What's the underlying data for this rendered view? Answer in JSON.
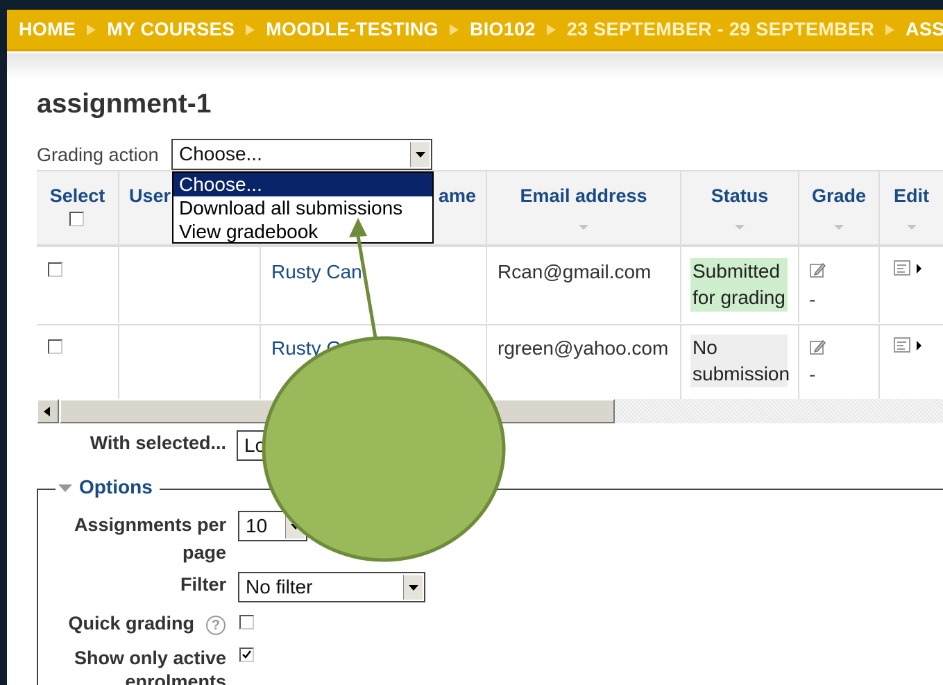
{
  "breadcrumb": {
    "items": [
      "HOME",
      "MY COURSES",
      "MOODLE-TESTING",
      "BIO102",
      "23 SEPTEMBER - 29 SEPTEMBER",
      "ASSIGNMEN"
    ]
  },
  "page": {
    "title": "assignment-1"
  },
  "grading_action": {
    "label": "Grading action",
    "selected": "Choose...",
    "options": [
      "Choose...",
      "Download all submissions",
      "View gradebook"
    ]
  },
  "table": {
    "headers": {
      "select": "Select",
      "user": "User",
      "name": "ame",
      "email": "Email address",
      "status": "Status",
      "grade": "Grade",
      "edit": "Edit"
    },
    "rows": [
      {
        "name": "Rusty Can",
        "email": "Rcan@gmail.com",
        "status_line1": "Submitted",
        "status_line2": "for grading",
        "grade": "-"
      },
      {
        "name": "Rusty G",
        "email": "rgreen@yahoo.com",
        "status_line1": "No",
        "status_line2": "submission",
        "grade": "-"
      }
    ]
  },
  "with_selected": {
    "label": "With selected...",
    "value": "Lo"
  },
  "options": {
    "legend": "Options",
    "assignments_per_page_label_1": "Assignments per",
    "assignments_per_page_label_2": "page",
    "assignments_per_page_value": "10",
    "filter_label": "Filter",
    "filter_value": "No filter",
    "quick_grading_label": "Quick grading",
    "show_active_label_1": "Show only active",
    "show_active_label_2": "enrolments"
  },
  "colors": {
    "breadcrumb_bar": "#e7b100",
    "link": "#1a4b85",
    "dropdown_selected": "#0a246a",
    "annotation_green": "#9ab95a",
    "annotation_outline": "#6f8c3a"
  }
}
